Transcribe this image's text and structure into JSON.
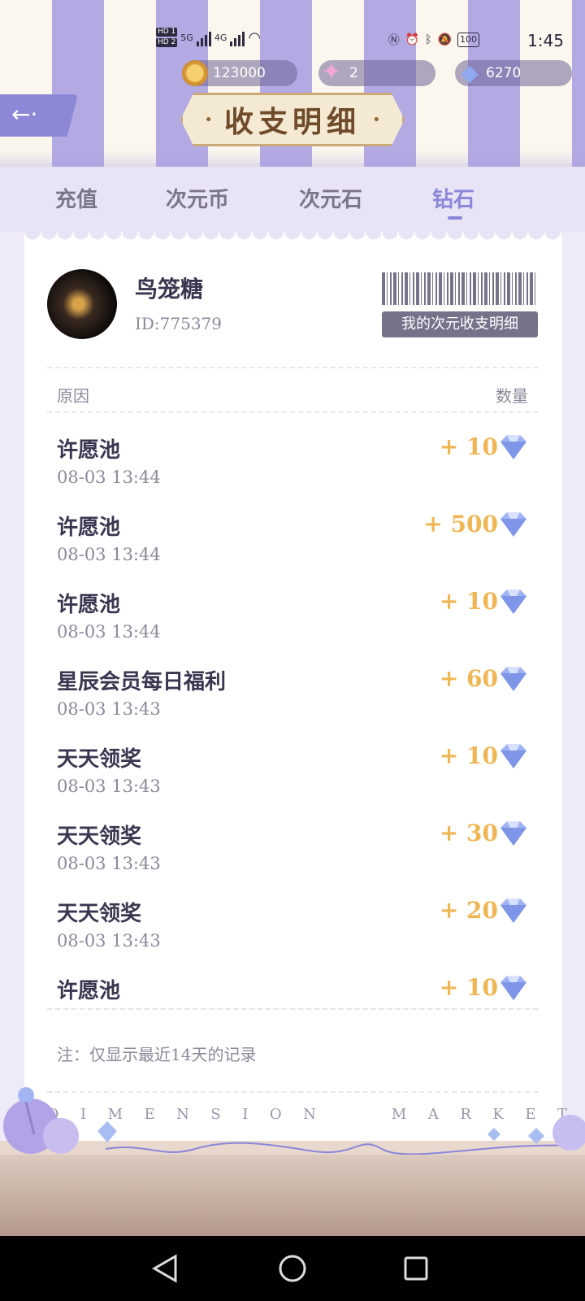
{
  "status_bar": {
    "hd1": "HD 1",
    "hd2": "HD 2",
    "net1": "5G",
    "net2": "4G",
    "battery": "100",
    "time": "1:45"
  },
  "currencies": [
    {
      "icon": "gold-coin-icon",
      "value": "123000"
    },
    {
      "icon": "star-icon",
      "value": "2"
    },
    {
      "icon": "diamond-icon",
      "value": "6270"
    }
  ],
  "header": {
    "title": "收支明细",
    "back_glyph": "←·"
  },
  "tabs": [
    {
      "label": "充值",
      "active": false
    },
    {
      "label": "次元币",
      "active": false
    },
    {
      "label": "次元石",
      "active": false
    },
    {
      "label": "钻石",
      "active": true
    }
  ],
  "profile": {
    "name": "鸟笼糖",
    "id": "ID:775379",
    "barcode_label": "我的次元收支明细"
  },
  "table": {
    "col_reason": "原因",
    "col_amount": "数量",
    "rows": [
      {
        "title": "许愿池",
        "time": "08-03 13:44",
        "amount": "+ 10"
      },
      {
        "title": "许愿池",
        "time": "08-03 13:44",
        "amount": "+ 500"
      },
      {
        "title": "许愿池",
        "time": "08-03 13:44",
        "amount": "+ 10"
      },
      {
        "title": "星辰会员每日福利",
        "time": "08-03 13:43",
        "amount": "+ 60"
      },
      {
        "title": "天天领奖",
        "time": "08-03 13:43",
        "amount": "+ 10"
      },
      {
        "title": "天天领奖",
        "time": "08-03 13:43",
        "amount": "+ 30"
      },
      {
        "title": "天天领奖",
        "time": "08-03 13:43",
        "amount": "+ 20"
      },
      {
        "title": "许愿池",
        "time": "",
        "amount": "+ 10"
      }
    ]
  },
  "note": "注：仅显示最近14天的记录",
  "footer_letters": [
    "D",
    "I",
    "M",
    "E",
    "N",
    "S",
    "I",
    "O",
    "N",
    "",
    "M",
    "A",
    "R",
    "K",
    "E",
    "T"
  ],
  "colors": {
    "accent": "#8a86d9",
    "amount": "#f0b654",
    "brown": "#6f4b2a"
  }
}
